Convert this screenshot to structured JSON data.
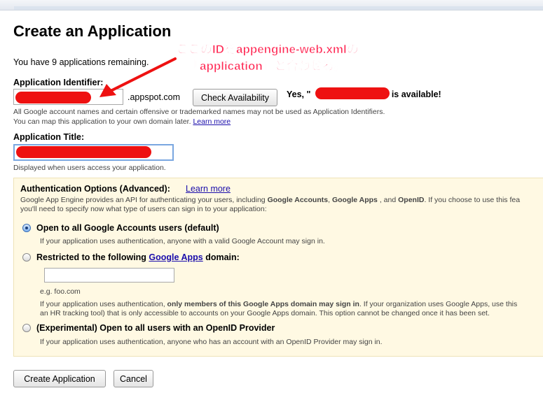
{
  "page": {
    "title": "Create an Application",
    "remaining": "You have 9 applications remaining."
  },
  "app_identifier": {
    "label": "Application Identifier:",
    "value": "",
    "suffix": ".appspot.com",
    "check_button": "Check Availability",
    "availability_prefix": "Yes, \"",
    "availability_suffix": "\" is available!",
    "help_line1": "All Google account names and certain offensive or trademarked names may not be used as Application Identifiers.",
    "help_line2": "You can map this application to your own domain later.",
    "learn_more": "Learn more"
  },
  "app_title": {
    "label": "Application Title:",
    "value": "",
    "help": "Displayed when users access your application."
  },
  "auth": {
    "heading": "Authentication Options (Advanced):",
    "learn_more": "Learn more",
    "intro_line1_a": "Google App Engine provides an API for authenticating your users, including ",
    "intro_line1_b": "Google Accounts",
    "intro_line1_c": ", ",
    "intro_line1_d": "Google Apps",
    "intro_line1_e": " , and ",
    "intro_line1_f": "OpenID",
    "intro_line1_g": ". If you choose to use this fea",
    "intro_line2": "you'll need to specify now what type of users can sign in to your application:",
    "options": [
      {
        "label": "Open to all Google Accounts users (default)",
        "description": "If your application uses authentication, anyone with a valid Google Account may sign in.",
        "checked": true
      },
      {
        "label_prefix": "Restricted to the following ",
        "label_link": "Google Apps",
        "label_suffix": " domain:",
        "domain_value": "",
        "example": "e.g. foo.com",
        "desc_a": "If your application uses authentication, ",
        "desc_b": "only members of this Google Apps domain may sign in",
        "desc_c": ". If your organization uses Google Apps, use this",
        "desc_line2": "an HR tracking tool) that is only accessible to accounts on your Google Apps domain. This option cannot be changed once it has been set.",
        "checked": false
      },
      {
        "label": "(Experimental) Open to all users with an OpenID Provider",
        "description": "If your application uses authentication, anyone who has an account with an OpenID Provider may sign in.",
        "checked": false
      }
    ]
  },
  "buttons": {
    "create": "Create Application",
    "cancel": "Cancel"
  },
  "annotation": {
    "line1": "ここのIDをappengine-web.xmlの",
    "line2": "『application』と合わせる。",
    "color": "#ff2a55"
  },
  "colors": {
    "redaction": "#ee1111",
    "auth_background": "#fff9e3",
    "link": "#1a0dab"
  }
}
